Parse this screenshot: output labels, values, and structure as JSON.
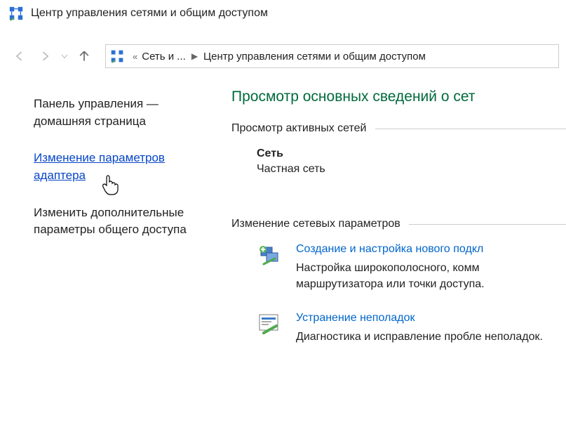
{
  "window": {
    "title": "Центр управления сетями и общим доступом"
  },
  "breadcrumb": {
    "ellipsis_prefix": "«",
    "item1": "Сеть и ...",
    "item2": "Центр управления сетями и общим доступом"
  },
  "sidebar": {
    "home": "Панель управления — домашняя страница",
    "adapter_settings": "Изменение параметров адаптера",
    "advanced_sharing": "Изменить дополнительные параметры общего доступа"
  },
  "main": {
    "heading": "Просмотр основных сведений о сет",
    "active_networks_label": "Просмотр активных сетей",
    "network": {
      "name": "Сеть",
      "type": "Частная сеть"
    },
    "change_settings_label": "Изменение сетевых параметров",
    "actions": {
      "create": {
        "title": "Создание и настройка нового подкл",
        "desc": "Настройка широкополосного, комм маршрутизатора или точки доступа."
      },
      "troubleshoot": {
        "title": "Устранение неполадок",
        "desc": "Диагностика и исправление пробле неполадок."
      }
    }
  }
}
